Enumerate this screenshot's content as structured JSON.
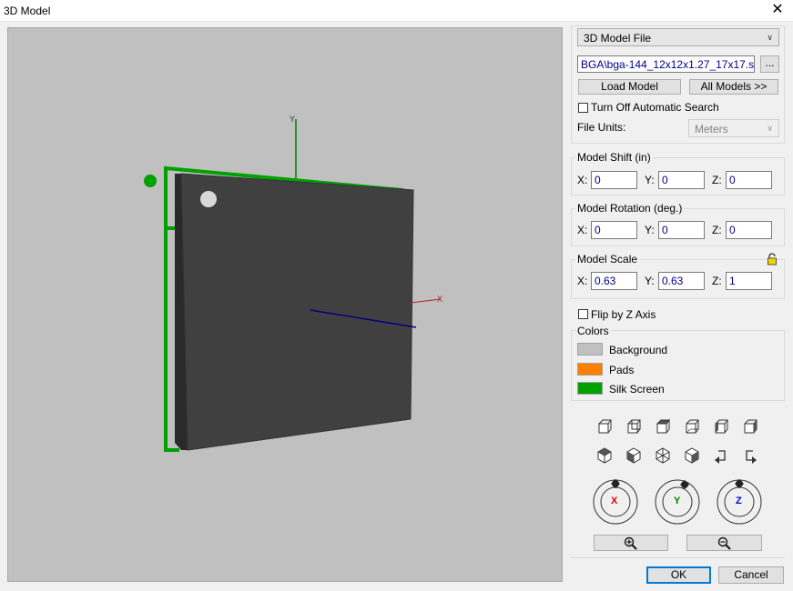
{
  "window": {
    "title": "3D Model",
    "close_glyph": "✕"
  },
  "viewport": {
    "x_axis_label": "X",
    "y_axis_label": "Y"
  },
  "model_file": {
    "type_select": "3D Model File",
    "path": "BGA\\bga-144_12x12x1.27_17x17.step",
    "browse_label": "...",
    "load_label": "Load Model",
    "all_models_label": "All Models >>",
    "auto_search_label": "Turn Off Automatic Search",
    "file_units_label": "File Units:",
    "file_units_value": "Meters"
  },
  "model_shift": {
    "title": "Model Shift (in)",
    "x_label": "X:",
    "y_label": "Y:",
    "z_label": "Z:",
    "x": "0",
    "y": "0",
    "z": "0"
  },
  "model_rotation": {
    "title": "Model Rotation (deg.)",
    "x_label": "X:",
    "y_label": "Y:",
    "z_label": "Z:",
    "x": "0",
    "y": "0",
    "z": "0"
  },
  "model_scale": {
    "title": "Model Scale",
    "x_label": "X:",
    "y_label": "Y:",
    "z_label": "Z:",
    "x": "0.63",
    "y": "0.63",
    "z": "1"
  },
  "flip_label": "Flip by Z Axis",
  "colors": {
    "title": "Colors",
    "items": [
      {
        "label": "Background",
        "color": "#c0c0c0"
      },
      {
        "label": "Pads",
        "color": "#ff8000"
      },
      {
        "label": "Silk Screen",
        "color": "#00a000"
      }
    ]
  },
  "dials": {
    "x": "X",
    "y": "Y",
    "z": "Z"
  },
  "footer": {
    "ok_label": "OK",
    "cancel_label": "Cancel"
  }
}
